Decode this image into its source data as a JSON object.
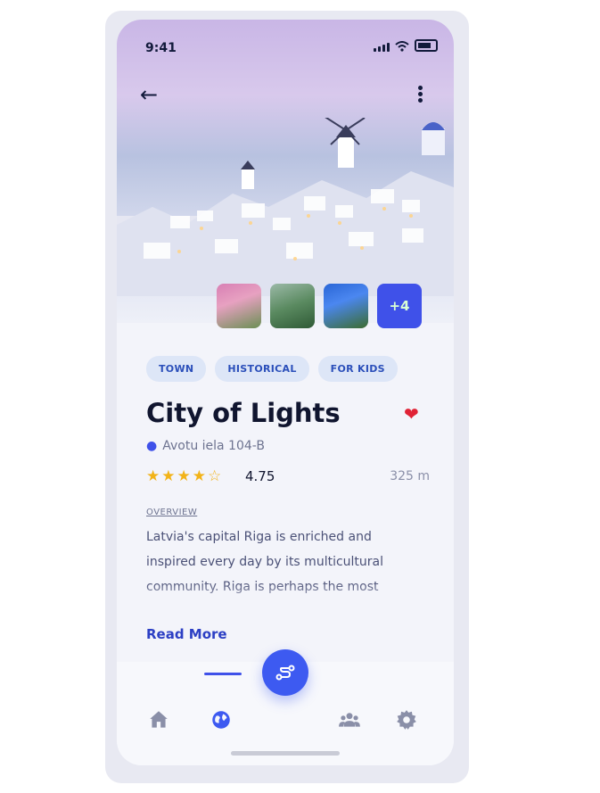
{
  "status_bar": {
    "time": "9:41"
  },
  "gallery": {
    "more_label": "+4"
  },
  "tags": [
    "TOWN",
    "HISTORICAL",
    "FOR KIDS"
  ],
  "place": {
    "title": "City of Lights",
    "address": "Avotu iela 104-B",
    "rating": "4.75",
    "stars": 4.5,
    "distance": "325 m",
    "overview_label": "OVERVIEW",
    "description": "Latvia's capital Riga is enriched and inspired every day by its multicultural community. Riga is perhaps the most",
    "read_more": "Read More"
  },
  "nav": {
    "items": [
      "home-icon",
      "globe-icon",
      "route-icon",
      "people-icon",
      "settings-icon"
    ],
    "active": "globe-icon"
  },
  "colors": {
    "accent": "#3d5af1",
    "heart": "#e02235",
    "star": "#f2b318"
  }
}
